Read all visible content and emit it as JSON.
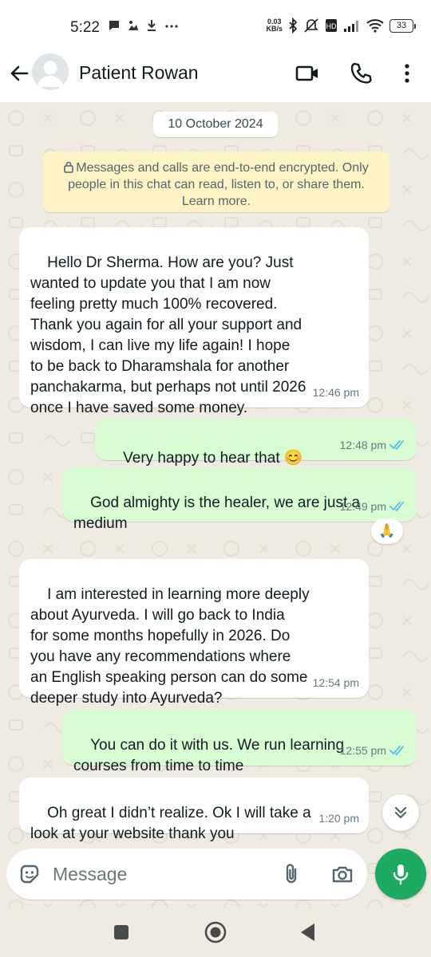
{
  "status_bar": {
    "time": "5:22",
    "left_icons": [
      "message-icon",
      "cast-icon",
      "download-icon",
      "more-dots"
    ],
    "net_speed_value": "0.03",
    "net_speed_unit": "KB/s",
    "battery": "33"
  },
  "header": {
    "contact_name": "Patient Rowan"
  },
  "chat": {
    "date_chip": "10 October 2024",
    "encryption_notice": "Messages and calls are end-to-end encrypted. Only people in this chat can read, listen to, or share them. Learn more.",
    "messages": [
      {
        "direction": "incoming",
        "text": "Hello Dr Sherma. How are you? Just\nwanted to update you that I am now\nfeeling pretty much 100% recovered.\nThank you again for all your support and\nwisdom, I can live my life again! I hope\nto be back to Dharamshala for another\npanchakarma, but perhaps not until 2026\nonce I have saved some money.",
        "time": "12:46 pm"
      },
      {
        "direction": "outgoing",
        "text": "Very happy to hear that 😊",
        "time": "12:48 pm",
        "status": "read"
      },
      {
        "direction": "outgoing",
        "text": "God almighty is the healer, we are just a\nmedium",
        "time": "12:49 pm",
        "status": "read",
        "reaction": "🙏"
      },
      {
        "direction": "incoming",
        "text": "I am interested in learning more deeply\nabout Ayurveda. I will go back to India\nfor some months hopefully in 2026. Do\nyou have any recommendations where\nan English speaking person can do some\ndeeper study into Ayurveda?",
        "time": "12:54 pm"
      },
      {
        "direction": "outgoing",
        "text": "You can do it with us. We run learning\ncourses from time to time",
        "time": "12:55 pm",
        "status": "read"
      },
      {
        "direction": "incoming",
        "text": "Oh great I didn’t realize. Ok I will take a\nlook at your website thank you",
        "time": "1:20 pm"
      }
    ]
  },
  "composer": {
    "placeholder": "Message"
  },
  "colors": {
    "incoming_bubble": "#ffffff",
    "outgoing_bubble": "#d9fdd3",
    "read_ticks": "#53bdeb",
    "accent_green": "#1daa61",
    "chat_background": "#efeae2",
    "encryption_notice_bg": "#fdf3c5"
  }
}
